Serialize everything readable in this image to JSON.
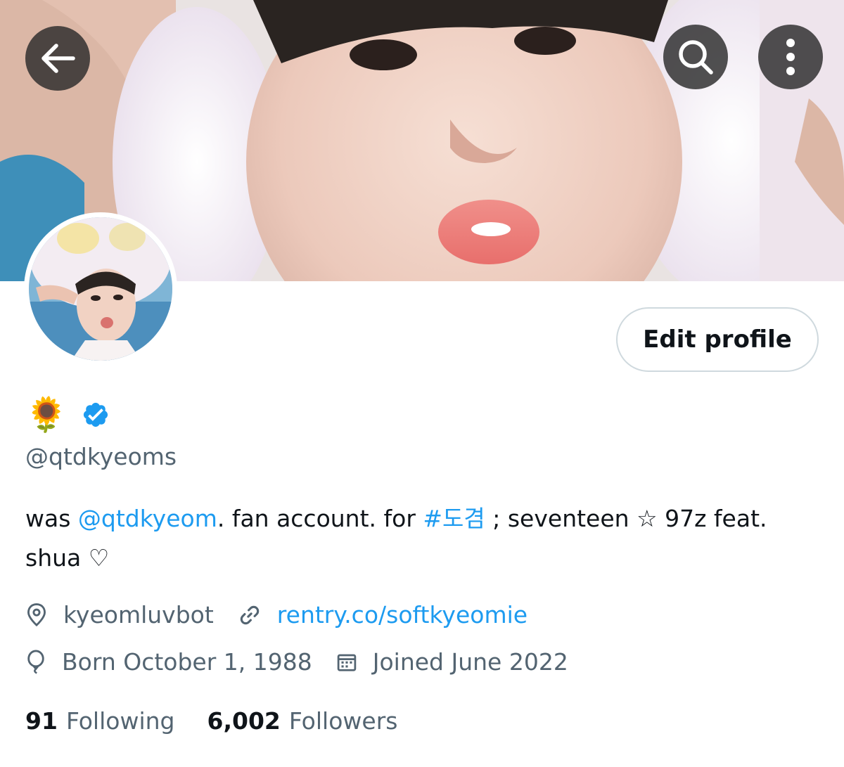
{
  "header": {
    "back_icon": "arrow-left-icon",
    "search_icon": "search-icon",
    "more_icon": "more-vertical-icon"
  },
  "profile": {
    "display_name_emoji": "🌻",
    "verified_icon": "verified-badge-icon",
    "handle": "@qtdkyeoms",
    "edit_button_label": "Edit profile",
    "bio": {
      "prefix": "was ",
      "mention": "@qtdkyeom",
      "middle": ". fan account. for ",
      "hashtag": "#도겸",
      "suffix": " ; seventeen ☆ 97z feat. shua ♡"
    },
    "location": "kyeomluvbot",
    "website": "rentry.co/softkyeomie",
    "birthday": "Born October 1, 1988",
    "joined": "Joined June 2022"
  },
  "stats": {
    "following_count": "91",
    "following_label": "Following",
    "followers_count": "6,002",
    "followers_label": "Followers"
  },
  "colors": {
    "link": "#1d9bf0",
    "secondary_text": "#536471",
    "primary_text": "#0f1419",
    "verified": "#1d9bf0"
  }
}
